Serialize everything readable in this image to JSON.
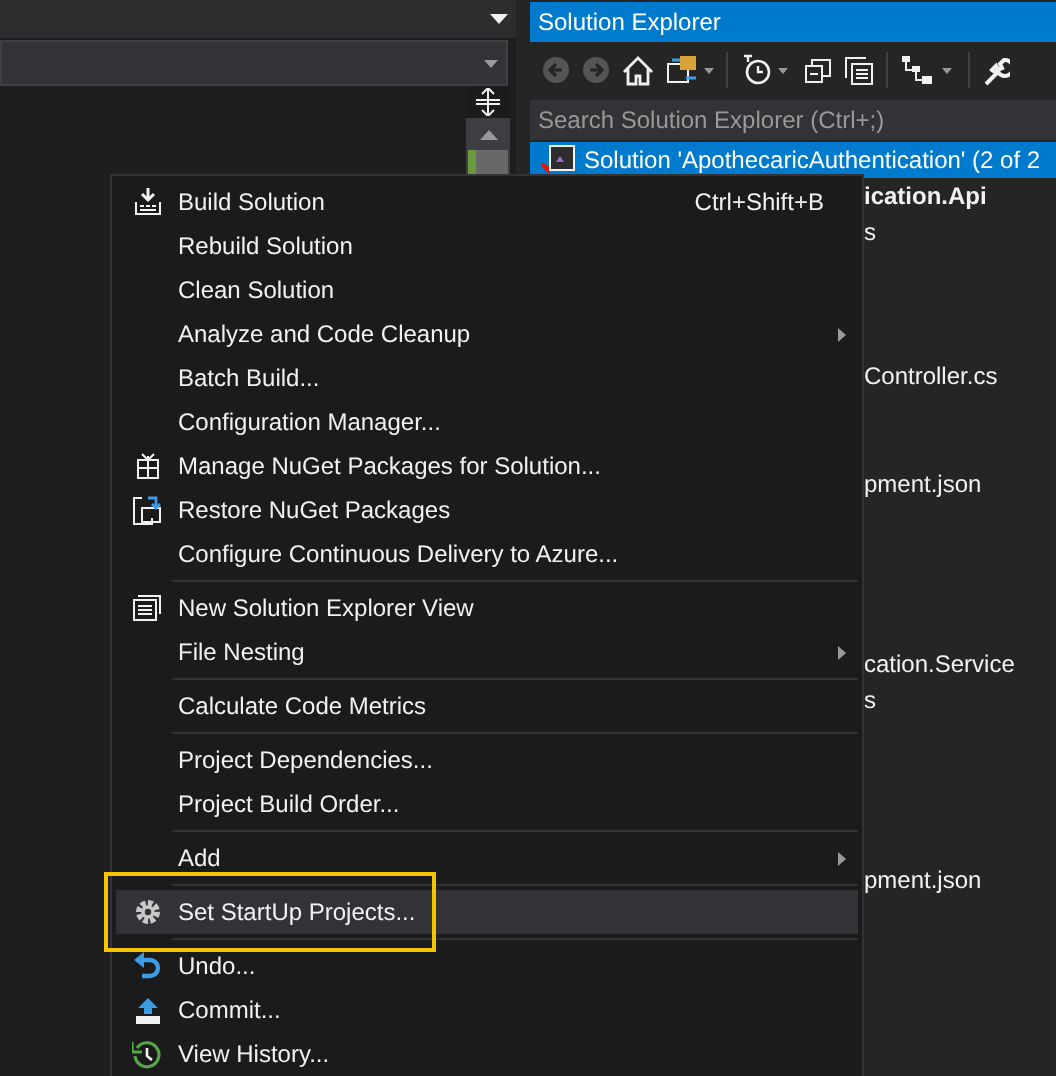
{
  "solution_explorer": {
    "title": "Solution Explorer",
    "search": {
      "placeholder": "Search Solution Explorer (Ctrl+;)"
    },
    "tree": [
      {
        "label": "Solution 'ApothecaricAuthentication' (2 of 2",
        "selected": true,
        "bold": false
      },
      {
        "label": "ication.Api",
        "selected": false,
        "bold": true
      },
      {
        "label": "s",
        "selected": false,
        "bold": false
      },
      {
        "label": "Controller.cs",
        "selected": false,
        "bold": false
      },
      {
        "label": "pment.json",
        "selected": false,
        "bold": false
      },
      {
        "label": "cation.Service",
        "selected": false,
        "bold": false
      },
      {
        "label": "s",
        "selected": false,
        "bold": false
      },
      {
        "label": "pment.json",
        "selected": false,
        "bold": false
      }
    ]
  },
  "context_menu": {
    "items": [
      {
        "kind": "item",
        "label": "Build Solution",
        "shortcut": "Ctrl+Shift+B",
        "has_submenu": false,
        "selected": false
      },
      {
        "kind": "item",
        "label": "Rebuild Solution",
        "has_submenu": false,
        "selected": false
      },
      {
        "kind": "item",
        "label": "Clean Solution",
        "has_submenu": false,
        "selected": false
      },
      {
        "kind": "item",
        "label": "Analyze and Code Cleanup",
        "has_submenu": true,
        "selected": false
      },
      {
        "kind": "item",
        "label": "Batch Build...",
        "has_submenu": false,
        "selected": false
      },
      {
        "kind": "item",
        "label": "Configuration Manager...",
        "has_submenu": false,
        "selected": false
      },
      {
        "kind": "item",
        "label": "Manage NuGet Packages for Solution...",
        "has_submenu": false,
        "selected": false
      },
      {
        "kind": "item",
        "label": "Restore NuGet Packages",
        "has_submenu": false,
        "selected": false
      },
      {
        "kind": "item",
        "label": "Configure Continuous Delivery to Azure...",
        "has_submenu": false,
        "selected": false
      },
      {
        "kind": "separator"
      },
      {
        "kind": "item",
        "label": "New Solution Explorer View",
        "has_submenu": false,
        "selected": false
      },
      {
        "kind": "item",
        "label": "File Nesting",
        "has_submenu": true,
        "selected": false
      },
      {
        "kind": "separator"
      },
      {
        "kind": "item",
        "label": "Calculate Code Metrics",
        "has_submenu": false,
        "selected": false
      },
      {
        "kind": "separator"
      },
      {
        "kind": "item",
        "label": "Project Dependencies...",
        "has_submenu": false,
        "selected": false
      },
      {
        "kind": "item",
        "label": "Project Build Order...",
        "has_submenu": false,
        "selected": false
      },
      {
        "kind": "separator"
      },
      {
        "kind": "item",
        "label": "Add",
        "has_submenu": true,
        "selected": false
      },
      {
        "kind": "separator"
      },
      {
        "kind": "item",
        "label": "Set StartUp Projects...",
        "has_submenu": false,
        "selected": true
      },
      {
        "kind": "separator"
      },
      {
        "kind": "item",
        "label": "Undo...",
        "has_submenu": false,
        "selected": false
      },
      {
        "kind": "item",
        "label": "Commit...",
        "has_submenu": false,
        "selected": false
      },
      {
        "kind": "item",
        "label": "View History...",
        "has_submenu": false,
        "selected": false
      }
    ]
  }
}
